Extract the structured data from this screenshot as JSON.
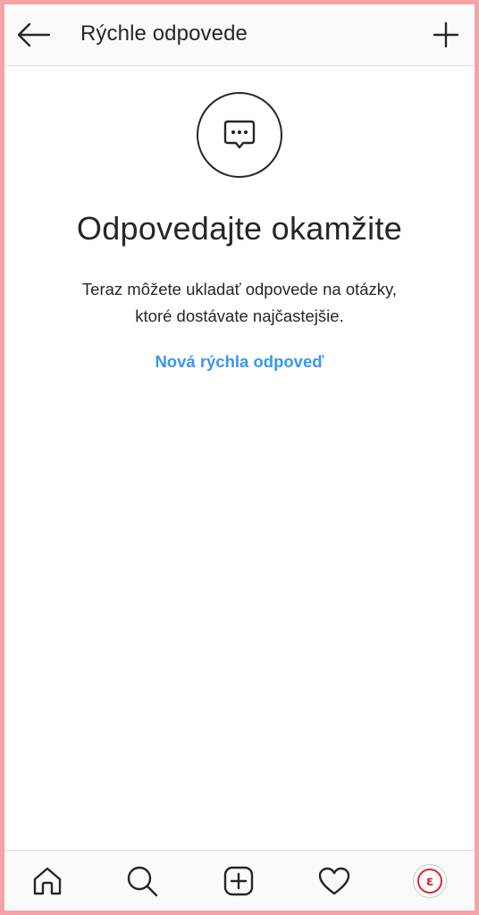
{
  "header": {
    "title": "Rýchle odpovede",
    "back_icon": "arrow-left-icon",
    "add_icon": "plus-icon"
  },
  "empty_state": {
    "icon": "chat-bubble-ellipsis-icon",
    "title": "Odpovedajte okamžite",
    "description_line1": "Teraz môžete ukladať odpovede na otázky,",
    "description_line2": "ktoré dostávate najčastejšie.",
    "action_label": "Nová rýchla odpoveď"
  },
  "bottom_nav": {
    "items": [
      {
        "icon": "home-icon"
      },
      {
        "icon": "search-icon"
      },
      {
        "icon": "add-post-icon"
      },
      {
        "icon": "heart-icon"
      },
      {
        "icon": "profile-avatar",
        "avatar_letter": "ε"
      }
    ]
  },
  "colors": {
    "link": "#3897f0",
    "text": "#262626",
    "frame_border": "#f4a3a6",
    "avatar_accent": "#e0242f"
  }
}
